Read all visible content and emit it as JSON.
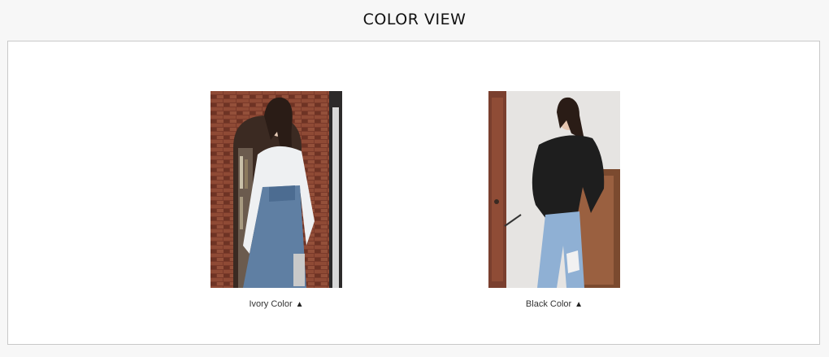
{
  "page": {
    "title": "COLOR VIEW"
  },
  "colors": {
    "panel_border": "#c9c9c9",
    "background": "#f7f7f7",
    "panel_background": "#ffffff"
  },
  "cards": [
    {
      "label": "Ivory Color",
      "arrow_icon": "triangle-up-icon",
      "arrow_glyph": "▲"
    },
    {
      "label": "Black Color",
      "arrow_icon": "triangle-up-icon",
      "arrow_glyph": "▲"
    }
  ]
}
